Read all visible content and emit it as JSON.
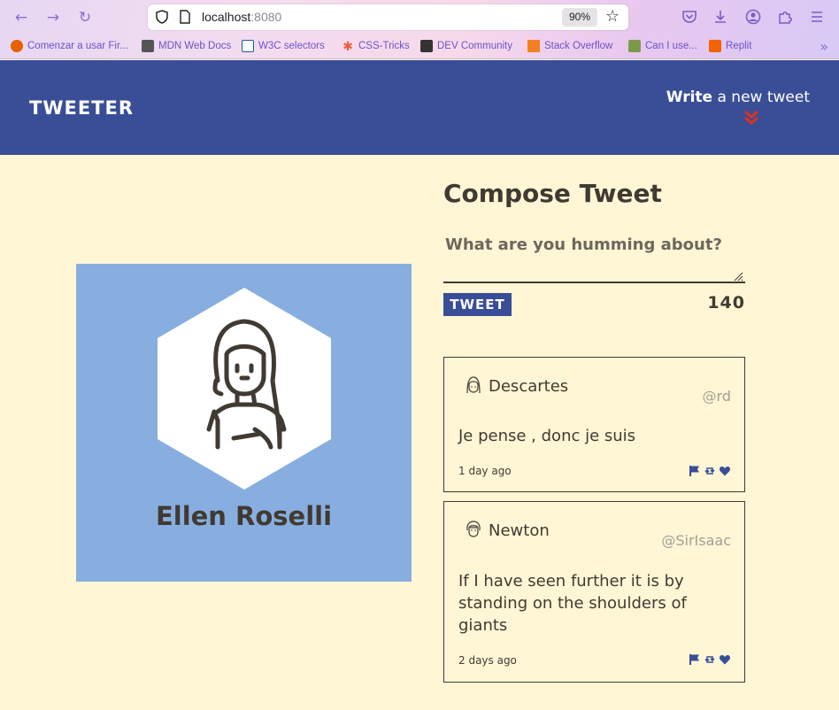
{
  "browser": {
    "url_host": "localhost",
    "url_port": ":8080",
    "zoom": "90%",
    "bookmarks": [
      {
        "label": "Comenzar a usar Fir...",
        "color": "#e66000"
      },
      {
        "label": "MDN Web Docs",
        "color": "#555555"
      },
      {
        "label": "W3C selectors",
        "color": "#1a5a9a"
      },
      {
        "label": "CSS-Tricks",
        "color": "#e8613c"
      },
      {
        "label": "DEV Community",
        "color": "#333333"
      },
      {
        "label": "Stack Overflow",
        "color": "#f48024"
      },
      {
        "label": "Can I use...",
        "color": "#7a9a4a"
      },
      {
        "label": "Replit",
        "color": "#f26207"
      }
    ]
  },
  "header": {
    "brand": "TWEETER",
    "write_bold": "Write",
    "write_rest": " a new tweet"
  },
  "profile": {
    "name": "Ellen Roselli",
    "bg_color": "#88aee0"
  },
  "compose": {
    "title": "Compose Tweet",
    "placeholder": "What are you humming about?",
    "button": "TWEET",
    "counter": "140"
  },
  "tweets": [
    {
      "name": "Descartes",
      "handle": "@rd",
      "text": "Je pense , donc je suis",
      "time": "1 day ago"
    },
    {
      "name": "Newton",
      "handle": "@SirIsaac",
      "text": "If I have seen further it is by standing on the shoulders of giants",
      "time": "2 days ago"
    }
  ],
  "colors": {
    "accent": "#3a4e97",
    "background": "#fff6d5",
    "text": "#403a32",
    "chevron": "#e0321e"
  }
}
